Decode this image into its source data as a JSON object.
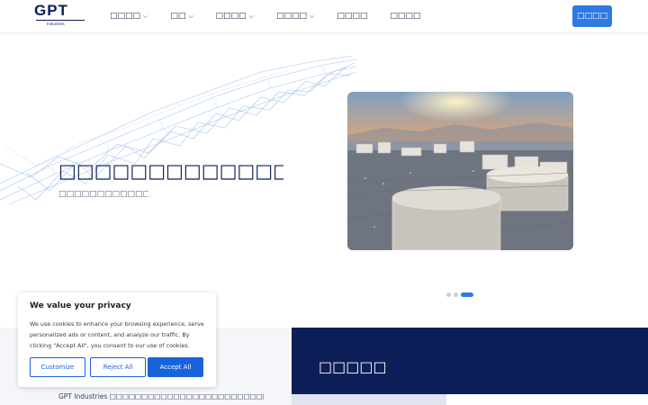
{
  "header": {
    "logo_text": "GPT",
    "logo_sub": "Industries",
    "nav": [
      {
        "label": "□□□□",
        "has_dropdown": true
      },
      {
        "label": "□□",
        "has_dropdown": true
      },
      {
        "label": "□□□□",
        "has_dropdown": true
      },
      {
        "label": "□□□□",
        "has_dropdown": true
      },
      {
        "label": "□□□□",
        "has_dropdown": false
      },
      {
        "label": "□□□□",
        "has_dropdown": false
      }
    ],
    "cta_label": "□□□□"
  },
  "hero": {
    "title": "□□□□□□□□□□□□□□□□□□□□",
    "subtitle": "□□□□□□□□□□□□□□□□□□□□",
    "slide_count": 3,
    "active_slide": 3
  },
  "section": {
    "title": "□□□□□",
    "description": "GPT Industries □□□□□□□□□□□□□□□□□□□□□□□□□□□□□□□□□□□□□□□□□□□□"
  },
  "cookie_banner": {
    "title": "We value your privacy",
    "text": "We use cookies to enhance your browsing experience, serve personalized ads or content, and analyze our traffic. By clicking \"Accept All\", you consent to our use of cookies.",
    "buttons": {
      "customize": "Customize",
      "reject": "Reject All",
      "accept": "Accept All"
    }
  },
  "colors": {
    "brand_navy": "#0c1f58",
    "accent_blue": "#2f7ae0",
    "cookie_blue": "#1863dc"
  }
}
